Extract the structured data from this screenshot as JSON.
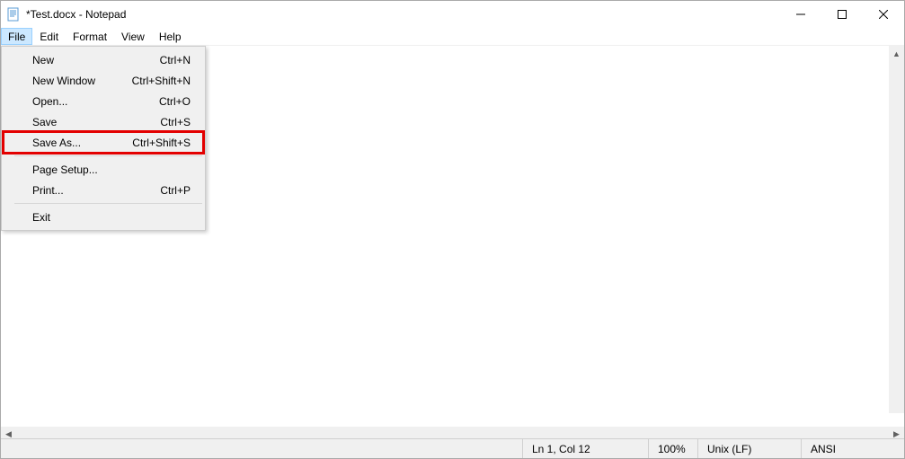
{
  "titlebar": {
    "title": "*Test.docx - Notepad"
  },
  "menubar": {
    "items": [
      "File",
      "Edit",
      "Format",
      "View",
      "Help"
    ],
    "active_index": 0
  },
  "file_menu": {
    "items": [
      {
        "label": "New",
        "shortcut": "Ctrl+N"
      },
      {
        "label": "New Window",
        "shortcut": "Ctrl+Shift+N"
      },
      {
        "label": "Open...",
        "shortcut": "Ctrl+O"
      },
      {
        "label": "Save",
        "shortcut": "Ctrl+S"
      },
      {
        "label": "Save As...",
        "shortcut": "Ctrl+Shift+S",
        "highlighted": true
      },
      {
        "separator": true
      },
      {
        "label": "Page Setup...",
        "shortcut": ""
      },
      {
        "label": "Print...",
        "shortcut": "Ctrl+P"
      },
      {
        "separator": true
      },
      {
        "label": "Exit",
        "shortcut": ""
      }
    ]
  },
  "statusbar": {
    "position": "Ln 1, Col 12",
    "zoom": "100%",
    "line_ending": "Unix (LF)",
    "encoding": "ANSI"
  }
}
